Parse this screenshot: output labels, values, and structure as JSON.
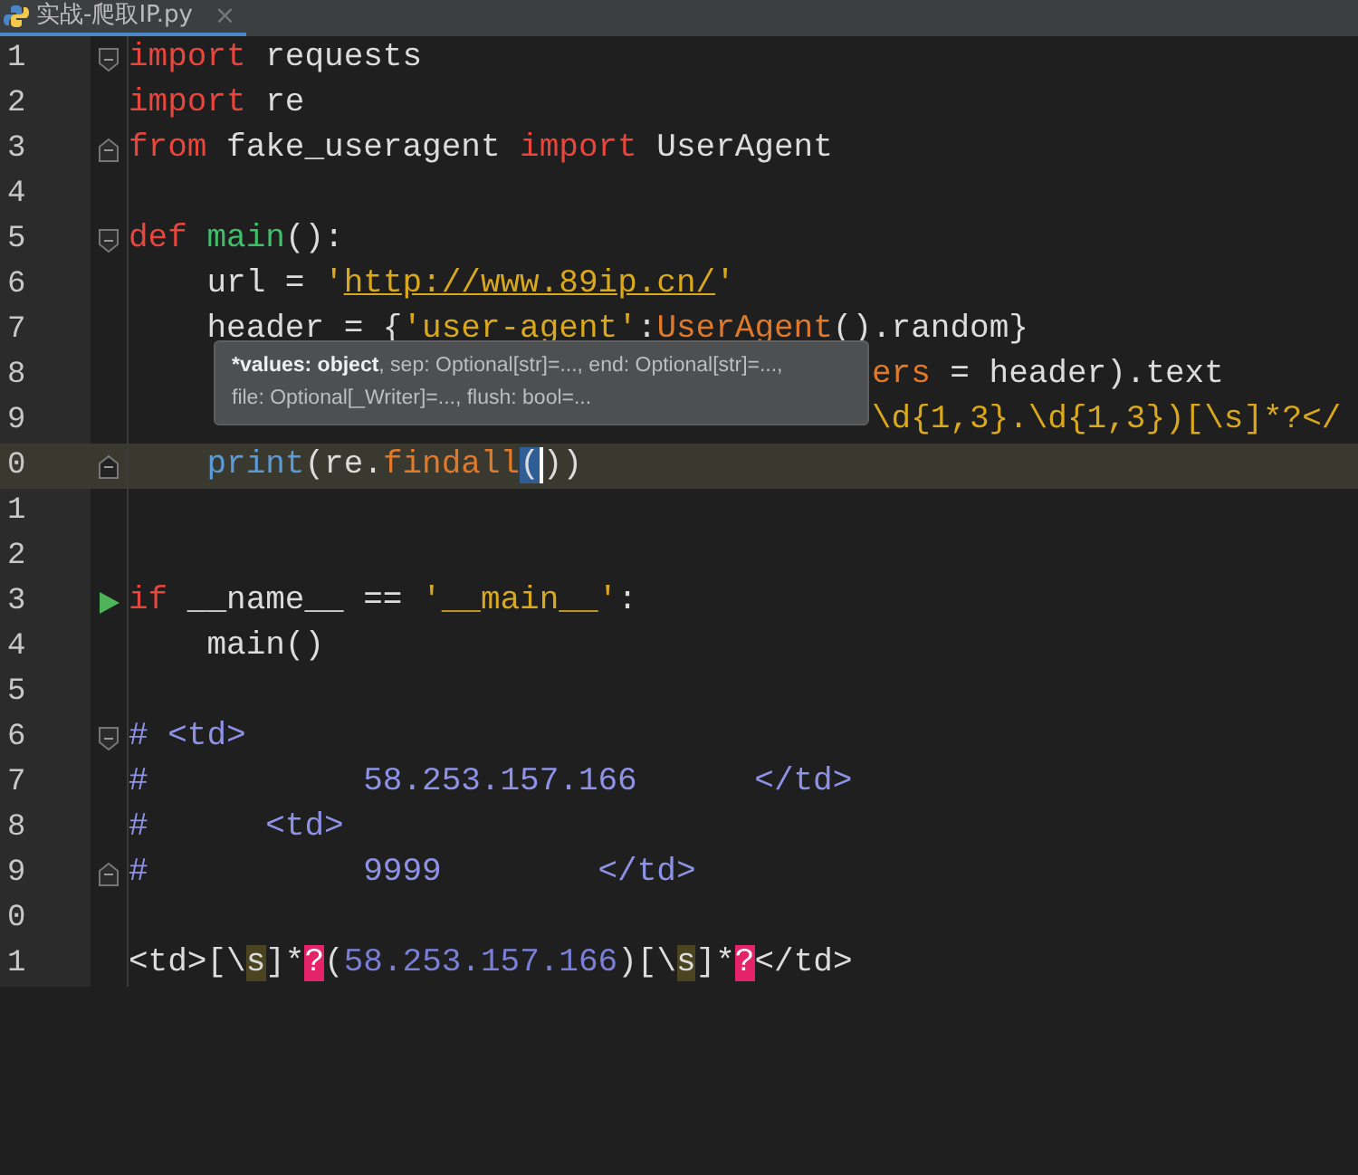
{
  "tab": {
    "title": "实战-爬取IP.py",
    "close": "×",
    "selected": true
  },
  "lines": [
    {
      "number": "1",
      "fold_start": true,
      "tokens": [
        {
          "kind": "kw",
          "text": "import"
        },
        {
          "kind": "plain",
          "text": " requests"
        }
      ]
    },
    {
      "number": "2",
      "tokens": [
        {
          "kind": "kw",
          "text": "import"
        },
        {
          "kind": "plain",
          "text": " re"
        }
      ]
    },
    {
      "number": "3",
      "fold_end": true,
      "tokens": [
        {
          "kind": "kw",
          "text": "from"
        },
        {
          "kind": "plain",
          "text": " fake_useragent "
        },
        {
          "kind": "kw",
          "text": "import"
        },
        {
          "kind": "plain",
          "text": " UserAgent"
        }
      ]
    },
    {
      "number": "4"
    },
    {
      "number": "5",
      "fold_start": true,
      "tokens": [
        {
          "kind": "kw",
          "text": "def "
        },
        {
          "kind": "fn",
          "text": "main"
        },
        {
          "kind": "plain",
          "text": "():"
        }
      ]
    },
    {
      "number": "6",
      "tokens": [
        {
          "kind": "plain",
          "text": "    url = "
        },
        {
          "kind": "str",
          "text": "'"
        },
        {
          "kind": "url",
          "text": "http://www.89ip.cn/"
        },
        {
          "kind": "str",
          "text": "'"
        }
      ]
    },
    {
      "number": "7",
      "tokens": [
        {
          "kind": "plain",
          "text": "    header = {"
        },
        {
          "kind": "str",
          "text": "'user-agent'"
        },
        {
          "kind": "plain",
          "text": ":"
        },
        {
          "kind": "cls",
          "text": "UserAgent"
        },
        {
          "kind": "plain",
          "text": "().random}"
        }
      ]
    },
    {
      "number": "8",
      "tokens": [
        {
          "kind": "cls",
          "text": "                                      ers"
        },
        {
          "kind": "plain",
          "text": " = header).text"
        }
      ]
    },
    {
      "number": "9",
      "tokens": [
        {
          "kind": "str",
          "text": "                                      \\d{1,3}.\\d{1,3})[\\s]*?</"
        }
      ]
    },
    {
      "number": "0",
      "fold_end": true,
      "current": true,
      "tokens": [
        {
          "kind": "builtin",
          "text": "    print"
        },
        {
          "kind": "plain",
          "text": "(re."
        },
        {
          "kind": "cls",
          "text": "findall"
        },
        {
          "kind": "match",
          "text": "("
        },
        {
          "kind": "plain",
          "text": "))"
        }
      ]
    },
    {
      "number": "1"
    },
    {
      "number": "2"
    },
    {
      "number": "3",
      "run": true,
      "tokens": [
        {
          "kind": "kw",
          "text": "if"
        },
        {
          "kind": "plain",
          "text": " __name__ == "
        },
        {
          "kind": "str",
          "text": "'__main__'"
        },
        {
          "kind": "plain",
          "text": ":"
        }
      ]
    },
    {
      "number": "4",
      "tokens": [
        {
          "kind": "plain",
          "text": "    main()"
        }
      ]
    },
    {
      "number": "5"
    },
    {
      "number": "6",
      "fold_start": true,
      "tokens": [
        {
          "kind": "comment",
          "text": "# <td>"
        }
      ]
    },
    {
      "number": "7",
      "tokens": [
        {
          "kind": "comment",
          "text": "#           58.253.157.166      </td>"
        }
      ]
    },
    {
      "number": "8",
      "tokens": [
        {
          "kind": "comment",
          "text": "#      <td>"
        }
      ]
    },
    {
      "number": "9",
      "fold_end": true,
      "tokens": [
        {
          "kind": "comment",
          "text": "#           9999        </td>"
        }
      ]
    },
    {
      "number": "0"
    },
    {
      "number": "1",
      "tokens": [
        {
          "kind": "plain",
          "text": "<td>[\\"
        },
        {
          "kind": "hls",
          "text": "s"
        },
        {
          "kind": "plain",
          "text": "]*"
        },
        {
          "kind": "hlq",
          "text": "?"
        },
        {
          "kind": "plain",
          "text": "("
        },
        {
          "kind": "num",
          "text": "58.253.157.166"
        },
        {
          "kind": "plain",
          "text": ")[\\"
        },
        {
          "kind": "hls",
          "text": "s"
        },
        {
          "kind": "plain",
          "text": "]*"
        },
        {
          "kind": "hlq",
          "text": "?"
        },
        {
          "kind": "plain",
          "text": "</td>"
        }
      ]
    }
  ],
  "tooltip": {
    "lines": [
      [
        {
          "text": "*values: object",
          "bold": true
        },
        {
          "text": ", sep: Optional[str]=..., end: Optional[str]=...,",
          "bold": false
        }
      ],
      [
        {
          "text": "file: Optional[_Writer]=..., flush: bool=...",
          "bold": false
        }
      ]
    ]
  }
}
